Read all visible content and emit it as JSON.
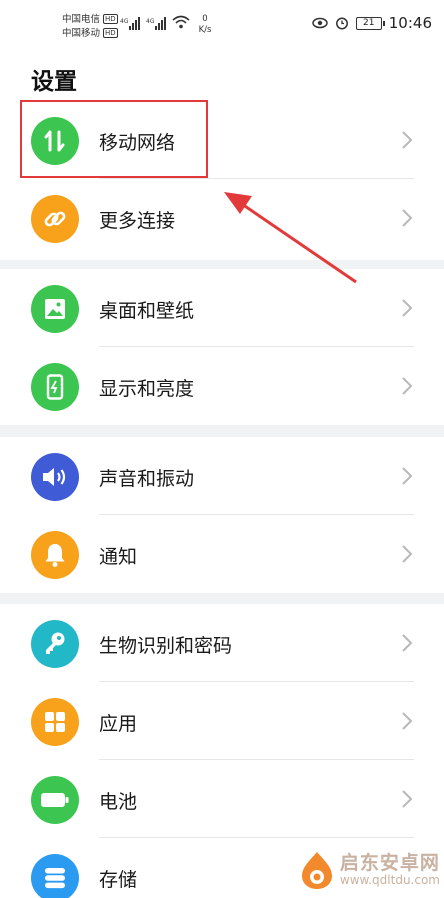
{
  "status_bar": {
    "carrier1": "中国电信",
    "carrier2": "中国移动",
    "hd": "HD",
    "net1": "4G",
    "net2": "4G",
    "speed_value": "0",
    "speed_unit": "K/s",
    "battery": "21",
    "time": "10:46"
  },
  "page": {
    "title": "设置"
  },
  "groups": [
    {
      "items": [
        {
          "label": "移动网络",
          "icon": "mobile-data-icon",
          "color": "#3cc651"
        },
        {
          "label": "更多连接",
          "icon": "link-icon",
          "color": "#f7a21a"
        }
      ]
    },
    {
      "items": [
        {
          "label": "桌面和壁纸",
          "icon": "wallpaper-icon",
          "color": "#3cc651"
        },
        {
          "label": "显示和亮度",
          "icon": "display-icon",
          "color": "#3cc651"
        }
      ]
    },
    {
      "items": [
        {
          "label": "声音和振动",
          "icon": "volume-icon",
          "color": "#3f5bd6"
        },
        {
          "label": "通知",
          "icon": "bell-icon",
          "color": "#f7a21a"
        }
      ]
    },
    {
      "items": [
        {
          "label": "生物识别和密码",
          "icon": "key-icon",
          "color": "#23b8c8"
        },
        {
          "label": "应用",
          "icon": "apps-icon",
          "color": "#f7a21a"
        },
        {
          "label": "电池",
          "icon": "battery-icon",
          "color": "#3cc651"
        },
        {
          "label": "存储",
          "icon": "storage-icon",
          "color": "#2a9bf0"
        }
      ]
    }
  ],
  "annotation": {
    "highlight_color": "#e23a3a"
  },
  "watermark": {
    "title": "启东安卓网",
    "url": "www.qdltdu.com"
  }
}
